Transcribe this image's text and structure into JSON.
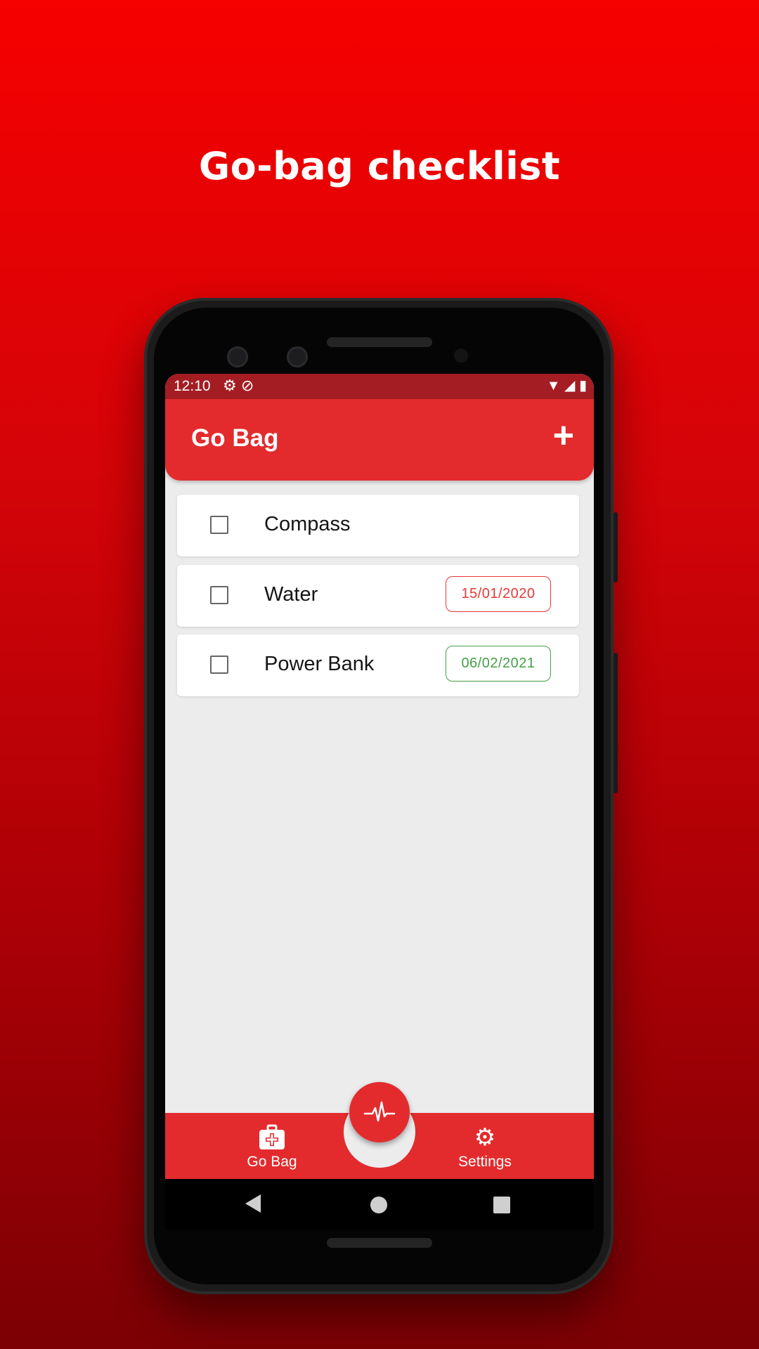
{
  "headline": "Go-bag checklist",
  "status_bar": {
    "time": "12:10",
    "left_icons": [
      "gear-icon",
      "data-saver-icon"
    ],
    "right_icons": [
      "wifi-icon",
      "signal-icon",
      "battery-icon"
    ]
  },
  "app_bar": {
    "title": "Go Bag",
    "add_icon": "+"
  },
  "items": [
    {
      "name": "Compass",
      "checked": false,
      "date": ""
    },
    {
      "name": "Water",
      "checked": false,
      "date": "15/01/2020",
      "date_color": "#e53935"
    },
    {
      "name": "Power Bank",
      "checked": false,
      "date": "06/02/2021",
      "date_color": "#43a047"
    }
  ],
  "bottom_nav": {
    "go_bag_label": "Go Bag",
    "settings_label": "Settings",
    "fab_icon": "heartbeat-icon"
  },
  "colors": {
    "primary": "#e32b2d",
    "status_bar": "#a41d22",
    "background": "#ececec"
  }
}
